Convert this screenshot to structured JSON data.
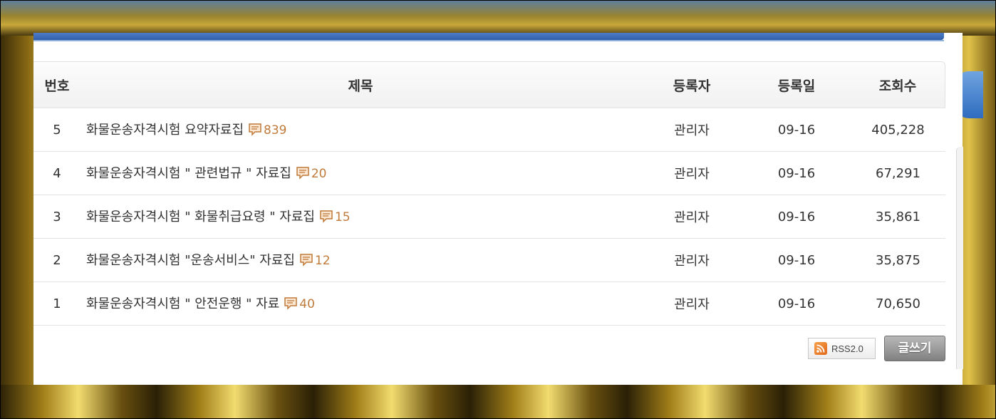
{
  "table": {
    "headers": {
      "num": "번호",
      "title": "제목",
      "author": "등록자",
      "date": "등록일",
      "views": "조회수"
    },
    "rows": [
      {
        "num": "5",
        "title": "화물운송자격시험 요약자료집",
        "comments": "839",
        "author": "관리자",
        "date": "09-16",
        "views": "405,228"
      },
      {
        "num": "4",
        "title": "화물운송자격시험 \" 관련법규 \" 자료집",
        "comments": "20",
        "author": "관리자",
        "date": "09-16",
        "views": "67,291"
      },
      {
        "num": "3",
        "title": "화물운송자격시험 \" 화물취급요령 \" 자료집",
        "comments": "15",
        "author": "관리자",
        "date": "09-16",
        "views": "35,861"
      },
      {
        "num": "2",
        "title": "화물운송자격시험 \"운송서비스\" 자료집",
        "comments": "12",
        "author": "관리자",
        "date": "09-16",
        "views": "35,875"
      },
      {
        "num": "1",
        "title": "화물운송자격시험 \" 안전운행 \" 자료",
        "comments": "40",
        "author": "관리자",
        "date": "09-16",
        "views": "70,650"
      }
    ]
  },
  "buttons": {
    "rss_label": "RSS2.0",
    "write_label": "글쓰기"
  },
  "colors": {
    "comment_count": "#c07a3a",
    "header_bar": "#3a69b4"
  },
  "icons": {
    "comment": "speech-bubble-icon",
    "rss": "rss-feed-icon"
  }
}
